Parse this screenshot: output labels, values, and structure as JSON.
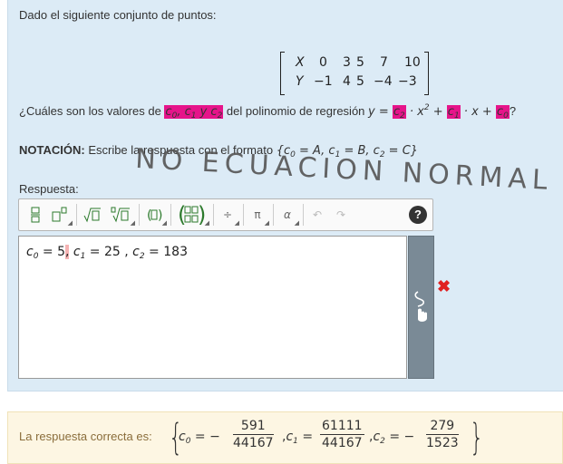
{
  "intro": "Dado el siguiente conjunto de puntos:",
  "matrix": {
    "row1_label": "X",
    "row1": [
      "0",
      "3",
      "5",
      "7",
      "10"
    ],
    "row2_label": "Y",
    "row2": [
      "−1",
      "4",
      "5",
      "−4",
      "−3"
    ]
  },
  "question": {
    "prefix": "¿Cuáles son los valores de ",
    "middle": " del polinomio de regresión ",
    "suffix": "?"
  },
  "notation": {
    "label": "NOTACIÓN:",
    "text": " Escribe la respuesta con el formato "
  },
  "handwritten_note": "NO ECUACION NORMAL",
  "response_label": "Respuesta:",
  "toolbar": {
    "help": "?"
  },
  "answer": {
    "c0_value": "5",
    "c1_value": "25",
    "c2_value": "183"
  },
  "correct": {
    "label": "La respuesta correcta es:",
    "c0_num": "591",
    "c0_den": "44167",
    "c1_num": "61111",
    "c1_den": "44167",
    "c2_num": "279",
    "c2_den": "1523"
  },
  "colors": {
    "highlight": "#e6148a",
    "panel": "#dcebf6",
    "error": "#e02020",
    "correct_bg": "#fdf6e3"
  }
}
